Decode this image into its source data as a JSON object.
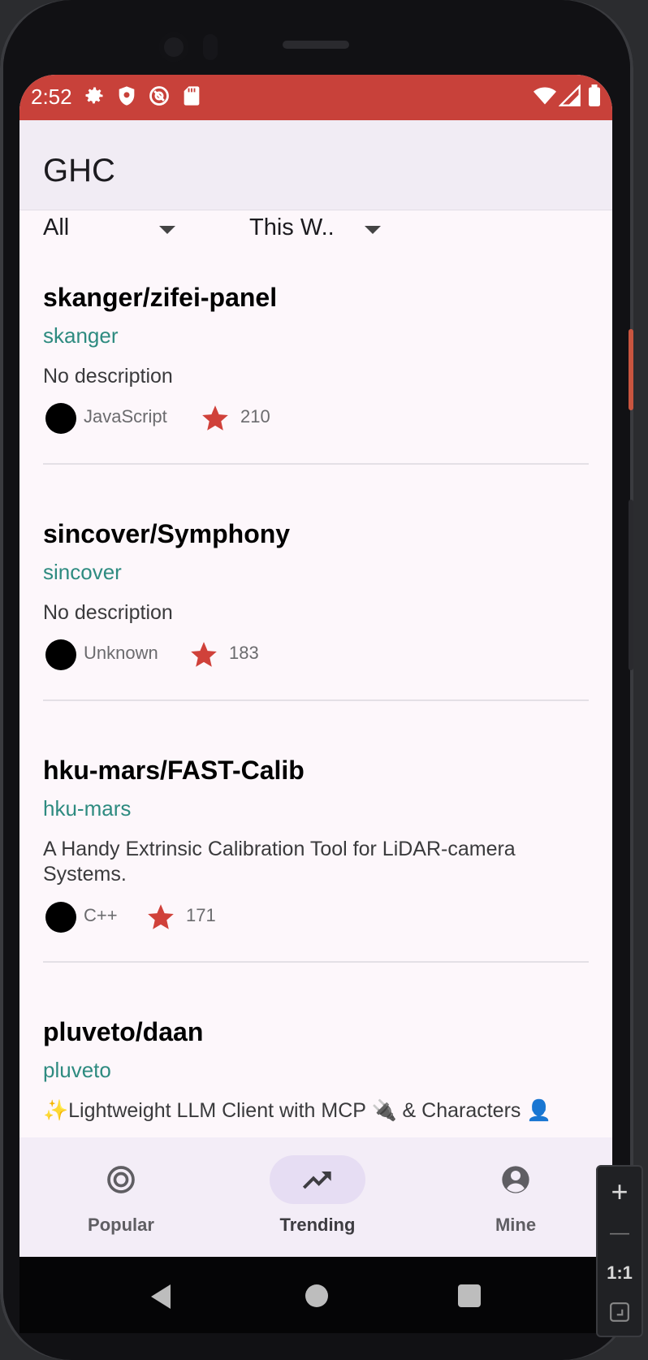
{
  "status_bar": {
    "time": "2:52",
    "left_icons": [
      "gear-icon",
      "shield-icon",
      "at-sign-icon",
      "sd-card-icon"
    ],
    "right_icons": [
      "wifi-icon",
      "signal-icon",
      "battery-icon"
    ],
    "color": "#c8413a"
  },
  "app_bar": {
    "title": "GHC"
  },
  "filters": {
    "language": "All",
    "period": "This W.."
  },
  "repos": [
    {
      "name": "skanger/zifei-panel",
      "owner": "skanger",
      "description": "No description",
      "language": "JavaScript",
      "stars": "210"
    },
    {
      "name": "sincover/Symphony",
      "owner": "sincover",
      "description": "No description",
      "language": "Unknown",
      "stars": "183"
    },
    {
      "name": "hku-mars/FAST-Calib",
      "owner": "hku-mars",
      "description": "A Handy Extrinsic Calibration Tool for LiDAR-camera Systems.",
      "language": "C++",
      "stars": "171"
    },
    {
      "name": "pluveto/daan",
      "owner": "pluveto",
      "description": "✨Lightweight LLM Client with MCP 🔌 & Characters 👤"
    }
  ],
  "bottom_nav": {
    "items": [
      {
        "label": "Popular",
        "icon": "target-icon",
        "active": false
      },
      {
        "label": "Trending",
        "icon": "trending-up-icon",
        "active": true
      },
      {
        "label": "Mine",
        "icon": "account-circle-icon",
        "active": false
      }
    ]
  },
  "zoom_controls": {
    "plus": "+",
    "minus": "—",
    "ratio": "1:1"
  },
  "colors": {
    "accent_owner": "#2e8b80",
    "star": "#d0413a",
    "nav_active": "#e6ddf3"
  }
}
